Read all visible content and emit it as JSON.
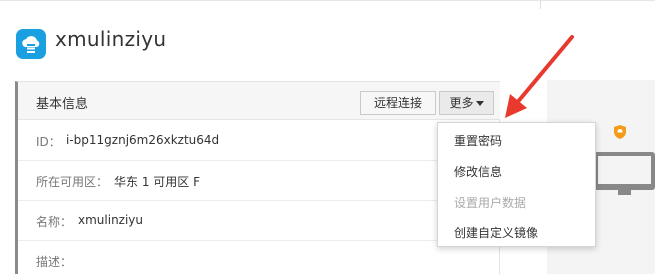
{
  "header": {
    "title": "xmulinziyu",
    "logo_icon": "cloud-server-icon"
  },
  "panel": {
    "title": "基本信息",
    "remote_button": "远程连接",
    "more_button": "更多",
    "rows": [
      {
        "label": "ID：",
        "value": "i-bp11gznj6m26xkztu64d"
      },
      {
        "label": "所在可用区：",
        "value": "华东 1 可用区 F"
      },
      {
        "label": "名称：",
        "value": "xmulinziyu"
      },
      {
        "label": "描述：",
        "value": ""
      }
    ]
  },
  "more_menu": {
    "items": [
      {
        "label": "重置密码",
        "enabled": true
      },
      {
        "label": "修改信息",
        "enabled": true
      },
      {
        "label": "设置用户数据",
        "enabled": false
      },
      {
        "label": "创建自定义镜像",
        "enabled": true
      }
    ]
  },
  "colors": {
    "accent": "#1aa0e0",
    "arrow": "#e8392f",
    "badge": "#f59b1a"
  }
}
